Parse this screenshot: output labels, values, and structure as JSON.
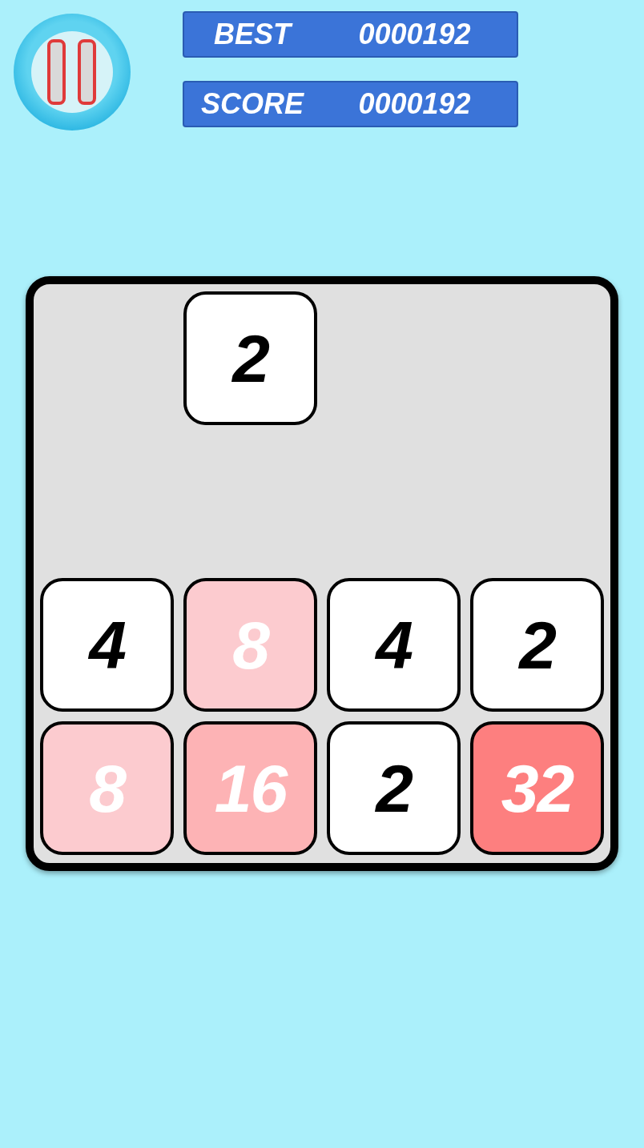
{
  "scores": [
    {
      "label": "BEST",
      "value": "0000192"
    },
    {
      "label": "SCORE",
      "value": "0000192"
    }
  ],
  "board": {
    "rows": [
      {
        "cells": [
          {
            "kind": "empty"
          },
          {
            "kind": "plain",
            "value": "2",
            "color": "#ffffff"
          },
          {
            "kind": "empty"
          },
          {
            "kind": "empty"
          }
        ]
      },
      {
        "cells": [
          {
            "kind": "empty"
          },
          {
            "kind": "empty"
          },
          {
            "kind": "empty"
          },
          {
            "kind": "empty"
          }
        ]
      },
      {
        "cells": [
          {
            "kind": "plain",
            "value": "4",
            "color": "#ffffff"
          },
          {
            "kind": "colored",
            "value": "8",
            "color": "#fccbcf"
          },
          {
            "kind": "plain",
            "value": "4",
            "color": "#ffffff"
          },
          {
            "kind": "plain",
            "value": "2",
            "color": "#ffffff"
          }
        ]
      },
      {
        "cells": [
          {
            "kind": "colored",
            "value": "8",
            "color": "#fccbcf"
          },
          {
            "kind": "colored",
            "value": "16",
            "color": "#fdb3b5"
          },
          {
            "kind": "plain",
            "value": "2",
            "color": "#ffffff"
          },
          {
            "kind": "colored",
            "value": "32",
            "color": "#fd7f7f"
          }
        ]
      }
    ]
  }
}
